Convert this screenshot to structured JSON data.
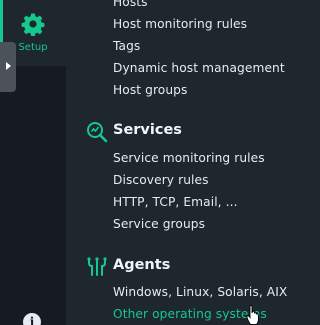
{
  "sidebar": {
    "setup_label": "Setup",
    "accent_color": "#15c88f",
    "icons": [
      "gear-icon",
      "info-icon"
    ],
    "info_glyph": "i"
  },
  "menu": {
    "hosts_items": [
      "Hosts",
      "Host monitoring rules",
      "Tags",
      "Dynamic host management",
      "Host groups"
    ],
    "services": {
      "title": "Services",
      "icon": "services-search-icon",
      "items": [
        "Service monitoring rules",
        "Discovery rules",
        "HTTP, TCP, Email, ...",
        "Service groups"
      ]
    },
    "agents": {
      "title": "Agents",
      "icon": "agents-icon",
      "items": [
        "Windows, Linux, Solaris, AIX",
        "Other operating systems"
      ],
      "hovered_item": "Other operating systems"
    }
  }
}
